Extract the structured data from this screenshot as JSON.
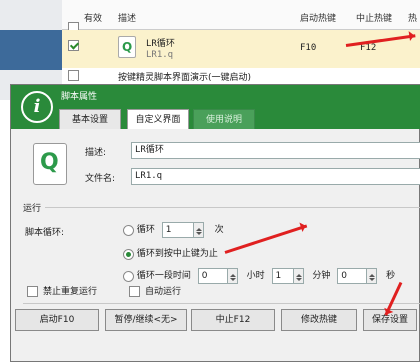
{
  "bg_table": {
    "headers": {
      "enabled": "有效",
      "description": "描述",
      "start_hotkey": "启动热键",
      "stop_hotkey": "中止热键",
      "extra": "热"
    },
    "selected_row": {
      "name": "LR循环",
      "file": "LR1.q",
      "start": "F10",
      "stop": "F12"
    },
    "next_row_text": "按键精灵脚本界面演示(一键启动)"
  },
  "dialog": {
    "title": "脚本属性",
    "logo_letter": "i",
    "tabs": [
      "基本设置",
      "自定义界面",
      "使用说明"
    ],
    "desc_label": "描述:",
    "desc_value": "LR循环",
    "file_label": "文件名:",
    "file_value": "LR1.q",
    "icon_letter": "Q",
    "run_section": "运行",
    "loop_label": "脚本循环:",
    "loop_option1": "循环",
    "loop_count": "1",
    "loop_unit": "次",
    "loop_option2": "循环到按中止键为止",
    "loop_option3": "循环一段时间",
    "hours": "0",
    "hours_unit": "小时",
    "minutes": "1",
    "minutes_unit": "分钟",
    "seconds": "0",
    "seconds_unit": "秒",
    "no_repeat_label": "禁止重复运行",
    "auto_run_label": "自动运行",
    "buttons": {
      "start": "启动F10",
      "pause": "暂停/继续<无>",
      "stop": "中止F12",
      "edit_hotkey": "修改热键",
      "save": "保存设置"
    }
  }
}
